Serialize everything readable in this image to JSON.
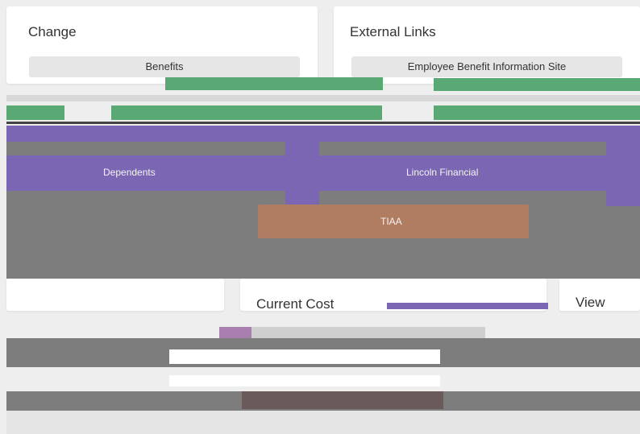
{
  "change_card": {
    "title": "Change",
    "benefits_button": "Benefits"
  },
  "external_links_card": {
    "title": "External Links",
    "employee_benefit_site_button": "Employee Benefit Information Site"
  },
  "overlay_buttons": {
    "dependents": "Dependents",
    "lincoln_financial": "Lincoln Financial",
    "tiaa": "TIAA"
  },
  "bottom_cards": {
    "current_cost_title": "Current Cost",
    "view_title": "View"
  },
  "colors": {
    "green": "#5aa974",
    "purple": "#7b66b3",
    "gray_band": "#7d7d7d",
    "tiaa_orange": "#b07d62"
  }
}
